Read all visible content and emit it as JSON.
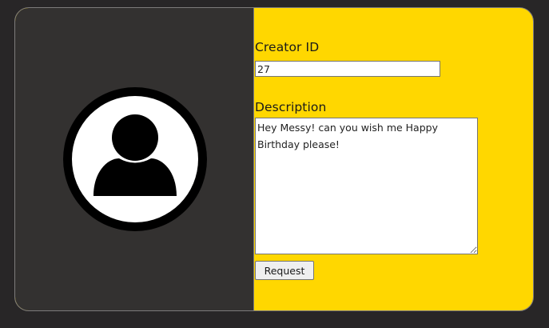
{
  "form": {
    "creator_id_label": "Creator ID",
    "creator_id_value": "27",
    "description_label": "Description",
    "description_value": "Hey Messy! can you wish me Happy Birthday please!",
    "request_label": "Request"
  },
  "colors": {
    "page_background": "#282627",
    "left_panel": "#333130",
    "form_panel": "#ffd700",
    "avatar_ring": "#000000",
    "avatar_fill": "#ffffff"
  },
  "icons": {
    "avatar": "user-avatar-icon"
  }
}
